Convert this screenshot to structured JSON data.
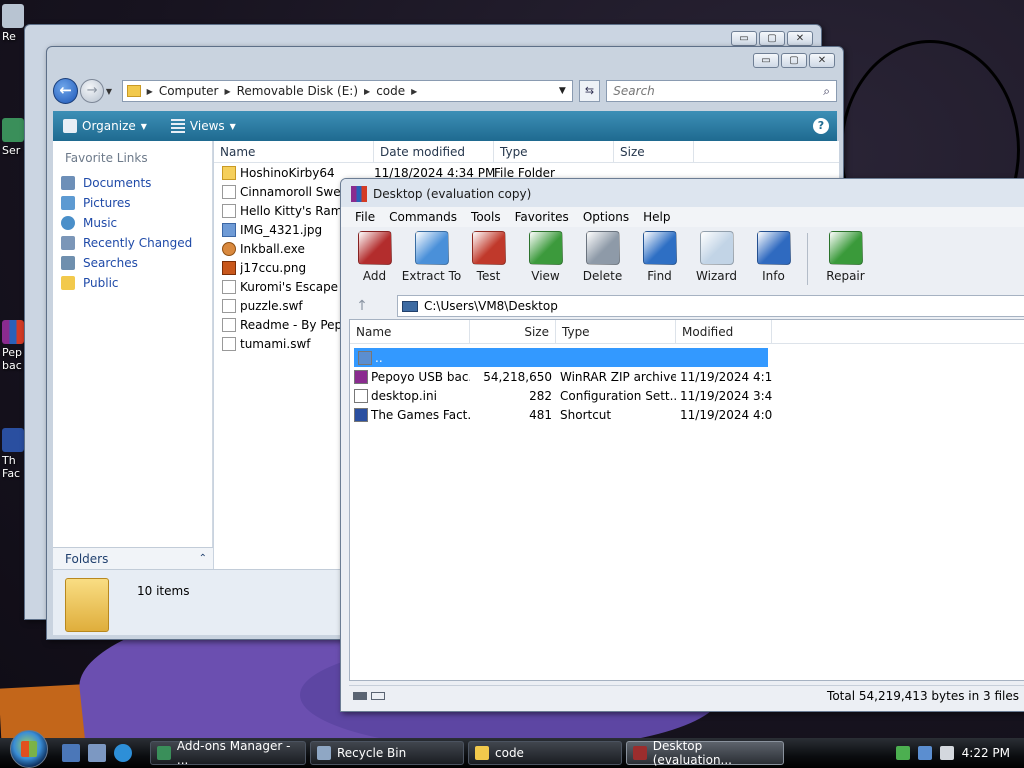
{
  "explorer_back": {
    "caption": {
      "min": "▭",
      "max": "▢",
      "close": "✕"
    }
  },
  "explorer": {
    "address": {
      "crumbs": [
        "Computer",
        "Removable Disk (E:)",
        "code"
      ]
    },
    "search_placeholder": "Search",
    "commands": {
      "organize": "Organize",
      "views": "Views",
      "help": "?"
    },
    "nav_header": "Favorite Links",
    "nav_links": [
      "Documents",
      "Pictures",
      "Music",
      "Recently Changed",
      "Searches",
      "Public"
    ],
    "folders_label": "Folders",
    "columns": [
      "Name",
      "Date modified",
      "Type",
      "Size"
    ],
    "files": [
      {
        "name": "HoshinoKirby64",
        "date": "11/18/2024 4:34 PM",
        "type": "File Folder",
        "kind": "folder"
      },
      {
        "name": "Cinnamoroll Sweet",
        "kind": "doc"
      },
      {
        "name": "Hello Kitty's Ramen",
        "kind": "doc"
      },
      {
        "name": "IMG_4321.jpg",
        "kind": "img"
      },
      {
        "name": "Inkball.exe",
        "kind": "exe"
      },
      {
        "name": "j17ccu.png",
        "kind": "png"
      },
      {
        "name": "Kuromi's Escape Ro",
        "kind": "doc"
      },
      {
        "name": "puzzle.swf",
        "kind": "doc"
      },
      {
        "name": "Readme - By Pepoy",
        "kind": "doc"
      },
      {
        "name": "tumami.swf",
        "kind": "doc"
      }
    ],
    "item_count": "10 items"
  },
  "winrar": {
    "title": "Desktop (evaluation copy)",
    "menu": [
      "File",
      "Commands",
      "Tools",
      "Favorites",
      "Options",
      "Help"
    ],
    "toolbar": [
      {
        "label": "Add",
        "icon": "add-archive-icon",
        "color": "#b32d2d"
      },
      {
        "label": "Extract To",
        "icon": "extract-folder-icon",
        "color": "#4a90d9"
      },
      {
        "label": "Test",
        "icon": "test-clipboard-icon",
        "color": "#c0392b"
      },
      {
        "label": "View",
        "icon": "view-book-icon",
        "color": "#3c9a3c"
      },
      {
        "label": "Delete",
        "icon": "delete-trash-icon",
        "color": "#8e9aa8"
      },
      {
        "label": "Find",
        "icon": "find-magnifier-icon",
        "color": "#2e6fc4"
      },
      {
        "label": "Wizard",
        "icon": "wizard-wand-icon",
        "color": "#c2d4e6"
      },
      {
        "label": "Info",
        "icon": "info-icon",
        "color": "#2f6ac0"
      },
      {
        "label": "Repair",
        "icon": "repair-kit-icon",
        "color": "#3a9a3a"
      }
    ],
    "path": "C:\\Users\\VM8\\Desktop",
    "columns": [
      "Name",
      "Size",
      "Type",
      "Modified"
    ],
    "rows": [
      {
        "name": "..",
        "size": "",
        "type": "",
        "modified": "",
        "selected": true
      },
      {
        "name": "Pepoyo USB bac...",
        "size": "54,218,650",
        "type": "WinRAR ZIP archive",
        "modified": "11/19/2024 4:1..."
      },
      {
        "name": "desktop.ini",
        "size": "282",
        "type": "Configuration Sett...",
        "modified": "11/19/2024 3:4..."
      },
      {
        "name": "The Games Fact...",
        "size": "481",
        "type": "Shortcut",
        "modified": "11/19/2024 4:0..."
      }
    ],
    "status": "Total 54,219,413 bytes in 3 files"
  },
  "desktop_icons": [
    "Re",
    "Ser",
    "Pep bac",
    "Th Fac"
  ],
  "taskbar": {
    "buttons": [
      {
        "label": "Add-ons Manager - ...",
        "color": "#3a8f5a"
      },
      {
        "label": "Recycle Bin",
        "color": "#8fa7c4"
      },
      {
        "label": "code",
        "color": "#f2c94c"
      },
      {
        "label": "Desktop (evaluation...",
        "color": "#9b2d2d"
      }
    ],
    "clock": "4:22 PM"
  }
}
